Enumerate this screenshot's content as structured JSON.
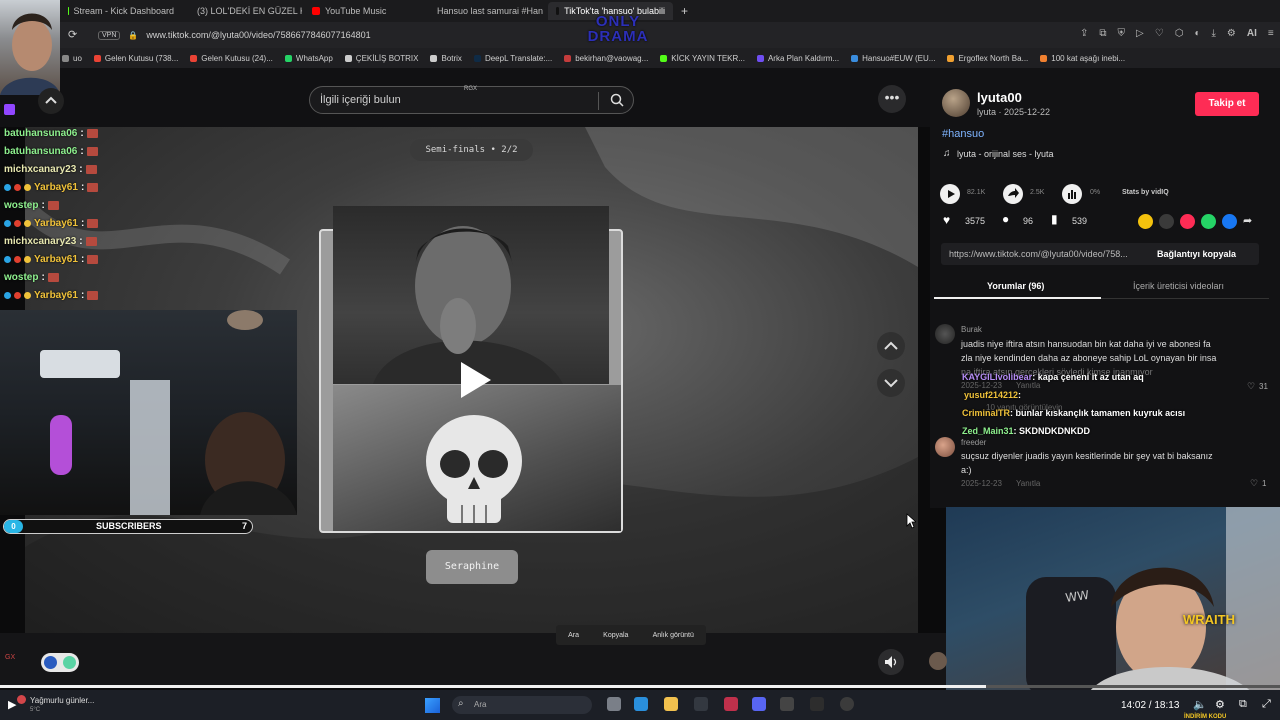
{
  "browser": {
    "tabs": [
      {
        "label": "Stream - Kick Dashboard",
        "color": "#53fc18"
      },
      {
        "label": "(3) LOL'DEKİ EN GÜZEL K",
        "color": "#ff0000"
      },
      {
        "label": "YouTube Music",
        "color": "#ff0000"
      },
      {
        "label": "Hansuo last samurai #Han",
        "color": "#2fb3d4"
      },
      {
        "label": "TikTok'ta 'hansuo' bulabili",
        "color": "#111111",
        "active": true
      }
    ],
    "new_tab": "+",
    "vpn_label": "VPN",
    "url": "www.tiktok.com/@lyuta00/video/7586677846077164801",
    "watermark_top": "ONLY",
    "watermark_bottom": "DRAMA",
    "ai_label": "AI",
    "bookmarks": [
      {
        "label": "uo",
        "color": "#888888"
      },
      {
        "label": "Gelen Kutusu (738...",
        "color": "#ea4335"
      },
      {
        "label": "Gelen Kutusu (24)...",
        "color": "#ea4335"
      },
      {
        "label": "WhatsApp",
        "color": "#25d366"
      },
      {
        "label": "ÇEKİLİŞ BOTRIX",
        "color": "#cccccc"
      },
      {
        "label": "Botrix",
        "color": "#cccccc"
      },
      {
        "label": "DeepL Translate:...",
        "color": "#0f2b46"
      },
      {
        "label": "bekirhan@vaowag...",
        "color": "#c43c3c"
      },
      {
        "label": "KİCK YAYIN TEKR...",
        "color": "#53fc18"
      },
      {
        "label": "Arka Plan Kaldırm...",
        "color": "#6f4ef2"
      },
      {
        "label": "Hansuo#EUW (EU...",
        "color": "#3a8dde"
      },
      {
        "label": "Ergoflex North Ba...",
        "color": "#f0a030"
      },
      {
        "label": "100 kat aşağı inebi...",
        "color": "#f08030"
      }
    ]
  },
  "tiktok": {
    "search_placeholder": "İlgili içeriği bulun",
    "rgx": "RGX",
    "more": "•••",
    "semis_label": "Semi-finals • 2/2",
    "champion_label": "Seraphine",
    "context_menu": [
      "Ara",
      "Kopyala",
      "Anlık görüntü"
    ],
    "author": {
      "username": "lyuta00",
      "subline": "lyuta · 2025-12-22",
      "follow": "Takip et"
    },
    "hashtag": "#hansuo",
    "sound": "lyuta - orijinal ses - lyuta",
    "stats_small": [
      "82.1K",
      "2.5K",
      "0%"
    ],
    "stats_by": "Stats by vidIQ",
    "likes": "3575",
    "comments_count": "96",
    "saves": "539",
    "link_url": "https://www.tiktok.com/@lyuta00/video/758...",
    "copy_link": "Bağlantıyı kopyala",
    "tab_comments": "Yorumlar (96)",
    "tab_creator_videos": "İçerik üreticisi videoları",
    "comment1": {
      "author": "Burak",
      "text1": "juadis niye iftira atsın hansuodan bin kat daha iyi ve abonesi fa",
      "text2": "zla niye kendinden daha az aboneye sahip LoL oynayan bir insa",
      "text3": "na iftira atsın gerçekleri söyledi kimse inanmıyor",
      "date": "2025-12-23",
      "reply": "Yanıtla",
      "likes": "31",
      "view_replies": "10 yanıtı görüntüleyin"
    },
    "comment2": {
      "author": "freeder",
      "text1": "suçsuz diyenler juadis yayın kesitlerinde bir şey vat bi baksanız",
      "text2": "a:)",
      "date": "2025-12-23",
      "reply": "Yanıtla",
      "likes": "1"
    }
  },
  "stream_overlay": {
    "chat": [
      {
        "user": "batuhansuna06",
        "color": "#8ef08e"
      },
      {
        "user": "batuhansuna06",
        "color": "#8ef08e"
      },
      {
        "user": "michxcanary23",
        "color": "#e8e8b0"
      },
      {
        "user": "Yarbay61",
        "color": "#f0c23a",
        "badges": true
      },
      {
        "user": "wostep",
        "color": "#8ef08e"
      },
      {
        "user": "Yarbay61",
        "color": "#f0c23a",
        "badges": true
      },
      {
        "user": "michxcanary23",
        "color": "#e8e8b0"
      },
      {
        "user": "Yarbay61",
        "color": "#f0c23a",
        "badges": true
      },
      {
        "user": "wostep",
        "color": "#8ef08e"
      },
      {
        "user": "Yarbay61",
        "color": "#f0c23a",
        "badges": true
      }
    ],
    "chat_sep": ":",
    "subs_left": "0",
    "subs_label": "SUBSCRIBERS",
    "subs_right": "7",
    "overlay_chat": [
      {
        "user": "KAYGILIvolibear",
        "msg": ": kapa çeneni it az utan aq",
        "color": "#b58cf5"
      },
      {
        "user": "yusuf214212",
        "msg": ":",
        "color": "#f0c23a"
      },
      {
        "user": "CriminalTR",
        "msg": ": bunlar kıskançlık tamamen kuyruk acısı",
        "color": "#f0c23a"
      },
      {
        "user": "Zed_Main31",
        "msg": ": SKDNDKDNKDD",
        "color": "#8ef08e"
      }
    ],
    "wraith": "WRAITH",
    "gx": "GX"
  },
  "taskbar": {
    "weather": "Yağmurlu günler...",
    "weather_temp": "5°C",
    "search": "Ara",
    "time": "14:02 / 18:13",
    "yt_caption": "İNDİRİM KODU"
  }
}
